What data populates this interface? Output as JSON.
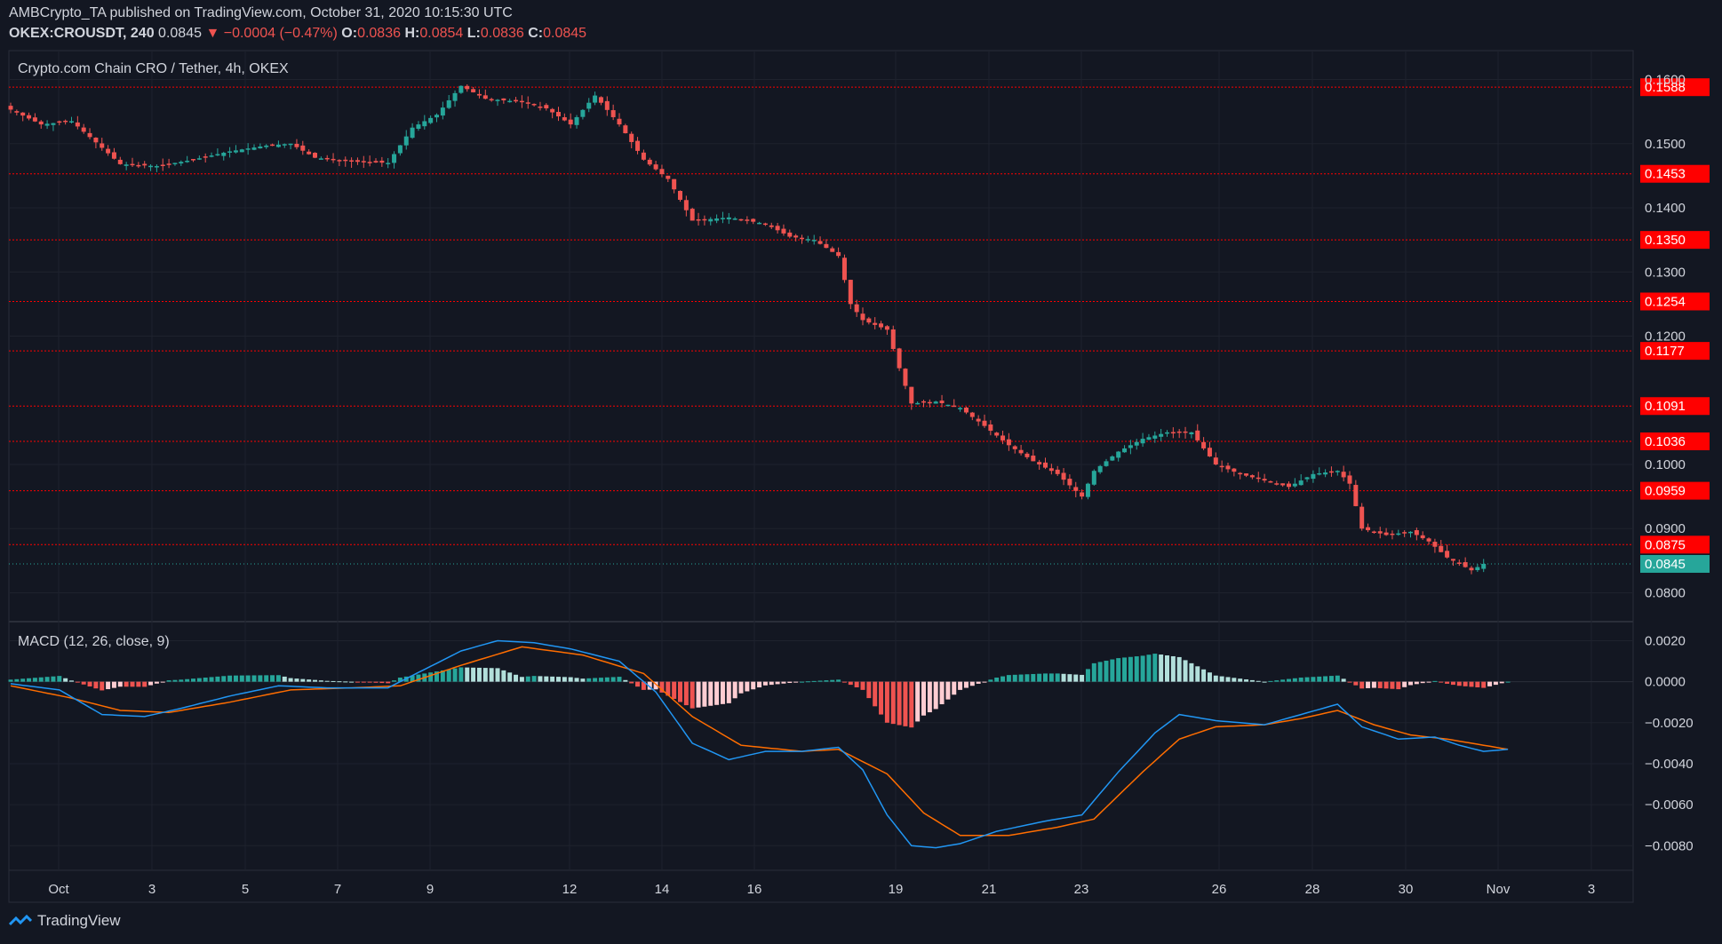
{
  "header": {
    "publisher_line": "AMBCrypto_TA published on TradingView.com, October 31, 2020 10:15:30 UTC",
    "symbol": "OKEX:CROUSDT, 240",
    "last": "0.0845",
    "change": "−0.0004 (−0.47%)",
    "o_label": "O:",
    "o": "0.0836",
    "h_label": "H:",
    "h": "0.0854",
    "l_label": "L:",
    "l": "0.0836",
    "c_label": "C:",
    "c": "0.0845"
  },
  "footer": {
    "brand": "TradingView"
  },
  "colors": {
    "background": "#131722",
    "up": "#26a69a",
    "down": "#ef5350",
    "hist_up_strong": "#26a69a",
    "hist_up_weak": "#b2dfdb",
    "hist_down_strong": "#ef5350",
    "hist_down_weak": "#ffcdd2",
    "macd_line": "#2196f3",
    "signal_line": "#ff6d00",
    "level_line": "#ff0000"
  },
  "chart_data": [
    {
      "type": "candlestick",
      "title": "Crypto.com Chain CRO / Tether, 4h, OKEX",
      "x_axis": [
        "Oct",
        "3",
        "5",
        "7",
        "9",
        "12",
        "14",
        "16",
        "19",
        "21",
        "23",
        "26",
        "28",
        "30",
        "Nov",
        "3"
      ],
      "y_ticks": [
        "0.1600",
        "0.1500",
        "0.1400",
        "0.1300",
        "0.1200",
        "0.1000",
        "0.0900",
        "0.0800"
      ],
      "ylim": [
        0.0755,
        0.1645
      ],
      "levels": [
        "0.1588",
        "0.1453",
        "0.1350",
        "0.1254",
        "0.1177",
        "0.1091",
        "0.1036",
        "0.0959",
        "0.0875"
      ],
      "last_price": "0.0845",
      "anchors": [
        [
          0,
          0.1553
        ],
        [
          5,
          0.153
        ],
        [
          10,
          0.1535
        ],
        [
          14,
          0.1502
        ],
        [
          18,
          0.1468
        ],
        [
          24,
          0.1465
        ],
        [
          30,
          0.1475
        ],
        [
          36,
          0.1488
        ],
        [
          42,
          0.1497
        ],
        [
          46,
          0.15
        ],
        [
          50,
          0.1478
        ],
        [
          56,
          0.1472
        ],
        [
          62,
          0.147
        ],
        [
          66,
          0.1525
        ],
        [
          70,
          0.1545
        ],
        [
          74,
          0.159
        ],
        [
          78,
          0.157
        ],
        [
          84,
          0.1565
        ],
        [
          88,
          0.1555
        ],
        [
          92,
          0.153
        ],
        [
          96,
          0.1575
        ],
        [
          100,
          0.153
        ],
        [
          104,
          0.1475
        ],
        [
          108,
          0.1445
        ],
        [
          112,
          0.138
        ],
        [
          118,
          0.1385
        ],
        [
          124,
          0.1375
        ],
        [
          128,
          0.1355
        ],
        [
          132,
          0.135
        ],
        [
          136,
          0.1325
        ],
        [
          138,
          0.125
        ],
        [
          140,
          0.1225
        ],
        [
          144,
          0.121
        ],
        [
          146,
          0.115
        ],
        [
          148,
          0.1095
        ],
        [
          152,
          0.1098
        ],
        [
          156,
          0.1088
        ],
        [
          160,
          0.106
        ],
        [
          164,
          0.103
        ],
        [
          168,
          0.1005
        ],
        [
          172,
          0.0985
        ],
        [
          176,
          0.095
        ],
        [
          178,
          0.099
        ],
        [
          182,
          0.102
        ],
        [
          186,
          0.104
        ],
        [
          190,
          0.105
        ],
        [
          194,
          0.105
        ],
        [
          198,
          0.1
        ],
        [
          202,
          0.0985
        ],
        [
          206,
          0.0975
        ],
        [
          210,
          0.0965
        ],
        [
          214,
          0.0985
        ],
        [
          218,
          0.099
        ],
        [
          220,
          0.097
        ],
        [
          222,
          0.09
        ],
        [
          226,
          0.089
        ],
        [
          230,
          0.0895
        ],
        [
          233,
          0.088
        ],
        [
          236,
          0.0855
        ],
        [
          240,
          0.0835
        ],
        [
          242,
          0.0845
        ]
      ]
    },
    {
      "type": "line+histogram",
      "title": "MACD (12, 26, close, 9)",
      "y_ticks": [
        "0.0020",
        "0.0000",
        "−0.0020",
        "−0.0040",
        "−0.0060",
        "−0.0080"
      ],
      "ylim": [
        -0.0092,
        0.0028
      ],
      "macd_anchors": [
        [
          0,
          -0.0001
        ],
        [
          8,
          -0.0004
        ],
        [
          15,
          -0.0016
        ],
        [
          22,
          -0.0017
        ],
        [
          28,
          -0.0013
        ],
        [
          36,
          -0.0007
        ],
        [
          44,
          -0.0002
        ],
        [
          52,
          -0.0003
        ],
        [
          62,
          -0.0003
        ],
        [
          68,
          0.0006
        ],
        [
          74,
          0.0015
        ],
        [
          80,
          0.002
        ],
        [
          86,
          0.0019
        ],
        [
          92,
          0.0016
        ],
        [
          100,
          0.001
        ],
        [
          106,
          -0.0005
        ],
        [
          112,
          -0.003
        ],
        [
          118,
          -0.0038
        ],
        [
          124,
          -0.0034
        ],
        [
          130,
          -0.0034
        ],
        [
          136,
          -0.0032
        ],
        [
          140,
          -0.0043
        ],
        [
          144,
          -0.0065
        ],
        [
          148,
          -0.008
        ],
        [
          152,
          -0.0081
        ],
        [
          156,
          -0.0079
        ],
        [
          162,
          -0.0073
        ],
        [
          170,
          -0.0068
        ],
        [
          176,
          -0.0065
        ],
        [
          182,
          -0.0044
        ],
        [
          188,
          -0.0025
        ],
        [
          192,
          -0.0016
        ],
        [
          198,
          -0.0019
        ],
        [
          206,
          -0.0021
        ],
        [
          212,
          -0.0016
        ],
        [
          218,
          -0.0011
        ],
        [
          222,
          -0.0022
        ],
        [
          228,
          -0.0028
        ],
        [
          234,
          -0.0027
        ],
        [
          238,
          -0.0031
        ],
        [
          242,
          -0.0034
        ],
        [
          246,
          -0.0033
        ]
      ],
      "signal_anchors": [
        [
          0,
          -0.0002
        ],
        [
          10,
          -0.0008
        ],
        [
          18,
          -0.0014
        ],
        [
          26,
          -0.0015
        ],
        [
          36,
          -0.001
        ],
        [
          46,
          -0.0004
        ],
        [
          56,
          -0.0003
        ],
        [
          64,
          -0.0002
        ],
        [
          74,
          0.0008
        ],
        [
          84,
          0.0017
        ],
        [
          94,
          0.0013
        ],
        [
          104,
          0.0004
        ],
        [
          112,
          -0.0017
        ],
        [
          120,
          -0.0031
        ],
        [
          130,
          -0.0034
        ],
        [
          136,
          -0.0033
        ],
        [
          144,
          -0.0045
        ],
        [
          150,
          -0.0064
        ],
        [
          156,
          -0.0075
        ],
        [
          164,
          -0.0075
        ],
        [
          172,
          -0.0071
        ],
        [
          178,
          -0.0067
        ],
        [
          186,
          -0.0044
        ],
        [
          192,
          -0.0028
        ],
        [
          198,
          -0.0022
        ],
        [
          206,
          -0.0021
        ],
        [
          212,
          -0.0018
        ],
        [
          218,
          -0.0014
        ],
        [
          224,
          -0.0021
        ],
        [
          230,
          -0.0026
        ],
        [
          236,
          -0.0028
        ],
        [
          242,
          -0.0031
        ],
        [
          246,
          -0.0033
        ]
      ]
    }
  ]
}
